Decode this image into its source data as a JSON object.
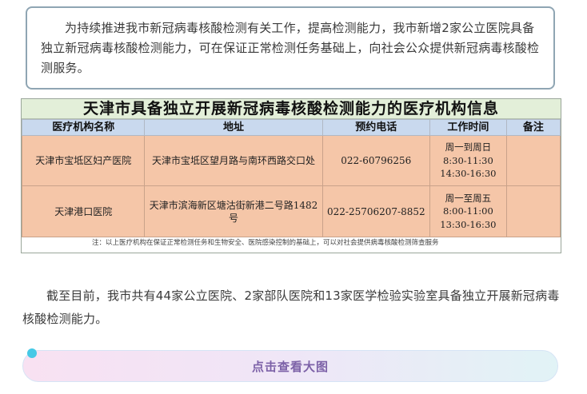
{
  "notice": {
    "text": "为持续推进我市新冠病毒核酸检测有关工作，提高检测能力，我市新增2家公立医院具备独立新冠病毒核酸检测能力，可在保证正常检测任务基础上，向社会公众提供新冠病毒核酸检测服务。"
  },
  "table": {
    "title": "天津市具备独立开展新冠病毒核酸检测能力的医疗机构信息",
    "headers": [
      "医疗机构名称",
      "地址",
      "预约电话",
      "工作时间",
      "备注"
    ],
    "rows": [
      {
        "name": "天津市宝坻区妇产医院",
        "address": "天津市宝坻区望月路与南环西路交口处",
        "phone": "022-60796256",
        "hours": [
          "周一到周日",
          "8:30-11:30",
          "14:30-16:30"
        ],
        "remark": ""
      },
      {
        "name": "天津港口医院",
        "address": "天津市滨海新区塘沽街新港二号路1482号",
        "phone": "022-25706207-8852",
        "hours": [
          "周一至周五",
          "8:00-11:00",
          "13:30-16:30"
        ],
        "remark": ""
      }
    ],
    "note": "注：以上医疗机构在保证正常检测任务和生物安全、医院感染控制的基础上，可以对社会提供病毒核酸检测筛查服务"
  },
  "summary": {
    "text": "截至目前，我市共有44家公立医院、2家部队医院和13家医学检验实验室具备独立开展新冠病毒核酸检测能力。"
  },
  "button": {
    "label": "点击查看大图"
  }
}
